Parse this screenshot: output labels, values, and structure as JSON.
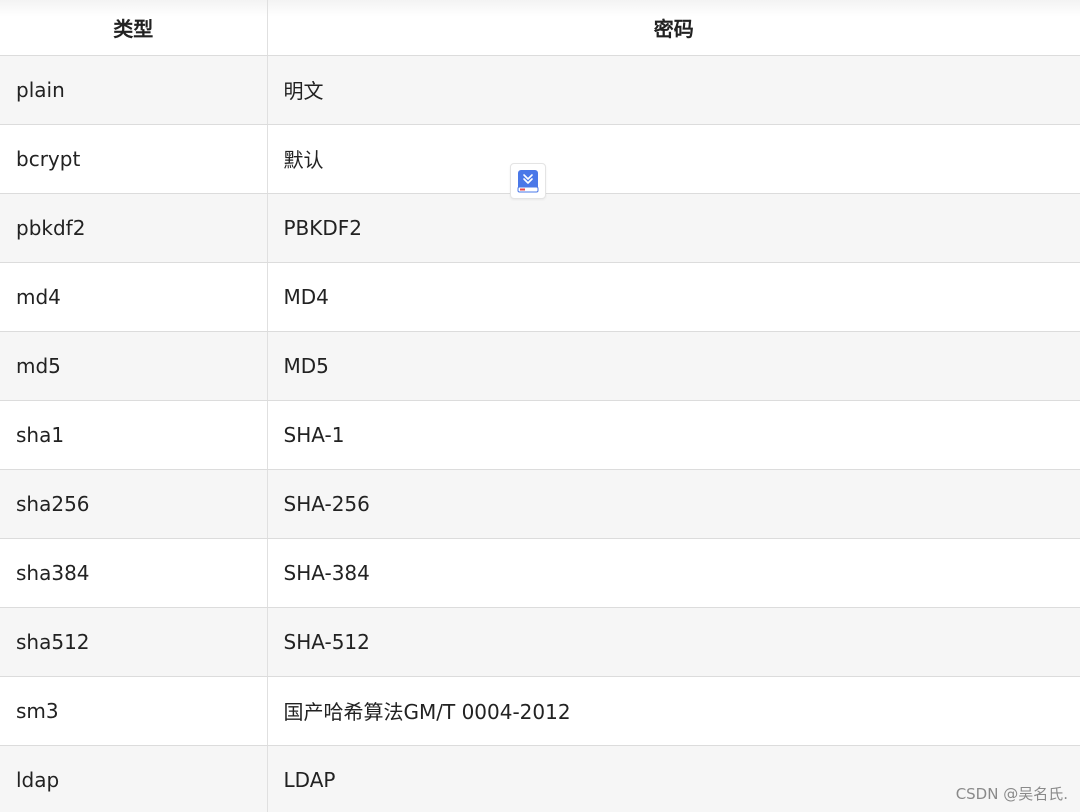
{
  "table": {
    "headers": [
      "类型",
      "密码"
    ],
    "rows": [
      [
        "plain",
        "明文"
      ],
      [
        "bcrypt",
        "默认"
      ],
      [
        "pbkdf2",
        "PBKDF2"
      ],
      [
        "md4",
        "MD4"
      ],
      [
        "md5",
        "MD5"
      ],
      [
        "sha1",
        "SHA-1"
      ],
      [
        "sha256",
        "SHA-256"
      ],
      [
        "sha384",
        "SHA-384"
      ],
      [
        "sha512",
        "SHA-512"
      ],
      [
        "sm3",
        "国产哈希算法GM/T 0004-2012"
      ],
      [
        "ldap",
        "LDAP"
      ]
    ]
  },
  "floating_icon": "download-book-icon",
  "watermark": "CSDN @吴名氏."
}
